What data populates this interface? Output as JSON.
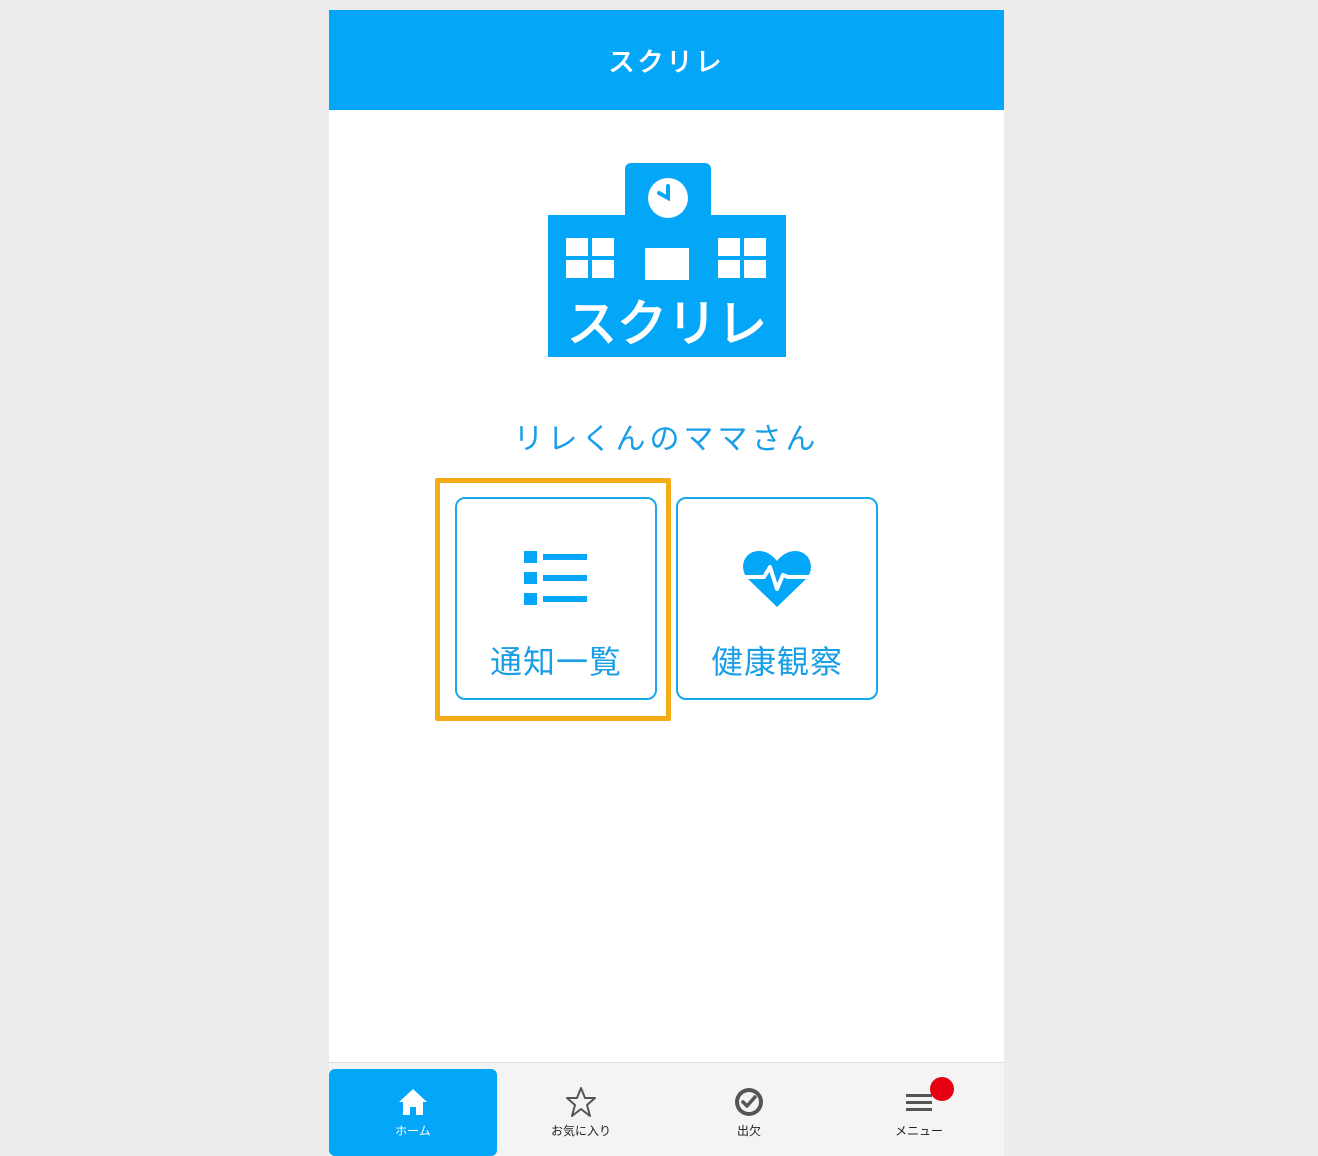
{
  "app": {
    "title": "スクリレ"
  },
  "logo": {
    "text": "スクリレ"
  },
  "user": {
    "name": "リレくんのママさん"
  },
  "tiles": [
    {
      "label": "通知一覧",
      "icon": "list-icon",
      "highlighted": true
    },
    {
      "label": "健康観察",
      "icon": "heartbeat-icon",
      "highlighted": false
    }
  ],
  "tabbar": {
    "items": [
      {
        "label": "ホーム",
        "icon": "home-icon",
        "active": true
      },
      {
        "label": "お気に入り",
        "icon": "star-icon",
        "active": false
      },
      {
        "label": "出欠",
        "icon": "check-circle-icon",
        "active": false
      },
      {
        "label": "メニュー",
        "icon": "menu-icon",
        "active": false,
        "badge": true
      }
    ]
  },
  "colors": {
    "brand": "#04a6f7",
    "text_accent": "#1a9ee6",
    "highlight": "#f5ab16",
    "badge": "#e60012"
  }
}
